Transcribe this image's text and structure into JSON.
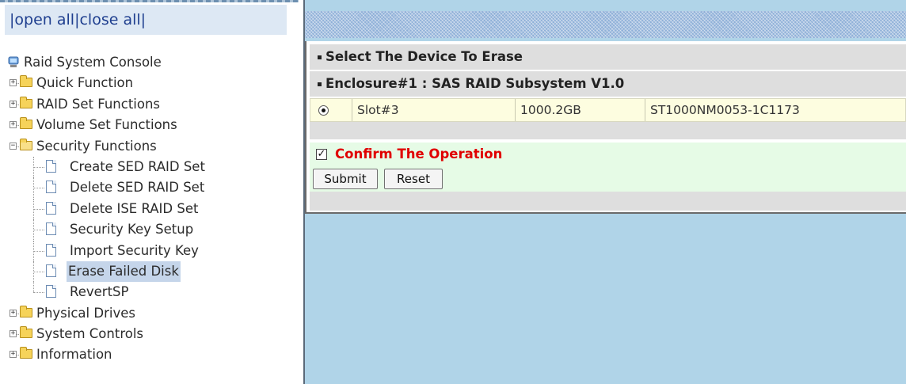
{
  "nav": {
    "open_close": {
      "pre": "|",
      "open_all": "open all",
      "sep": "|",
      "close_all": "close all",
      "post": "|"
    },
    "root": "Raid System Console",
    "items": [
      {
        "label": "Quick Function",
        "type": "folder",
        "expanded": false
      },
      {
        "label": "RAID Set Functions",
        "type": "folder",
        "expanded": false
      },
      {
        "label": "Volume Set Functions",
        "type": "folder",
        "expanded": false
      },
      {
        "label": "Security Functions",
        "type": "folder",
        "expanded": true,
        "children": [
          "Create SED RAID Set",
          "Delete SED RAID Set",
          "Delete ISE RAID Set",
          "Security Key Setup",
          "Import Security Key",
          "Erase Failed Disk",
          "RevertSP"
        ],
        "selected_child": "Erase Failed Disk"
      },
      {
        "label": "Physical Drives",
        "type": "folder",
        "expanded": false
      },
      {
        "label": "System Controls",
        "type": "folder",
        "expanded": false
      },
      {
        "label": "Information",
        "type": "folder",
        "expanded": false
      }
    ]
  },
  "main": {
    "section_title": "Select The Device To Erase",
    "enclosure_title": "Enclosure#1 : SAS RAID Subsystem V1.0",
    "device": {
      "selected": true,
      "slot": "Slot#3",
      "capacity": "1000.2GB",
      "model": "ST1000NM0053-1C1173"
    },
    "confirm": {
      "checked": true,
      "label": "Confirm The Operation",
      "color": "#e00000"
    },
    "buttons": {
      "submit": "Submit",
      "reset": "Reset"
    }
  },
  "colors": {
    "content_background": "#b0d4e8",
    "selected_item": "#c5d5ea",
    "confirm_background": "#e6fbe6",
    "device_row": "#fdfde0",
    "header_row": "#dedede"
  }
}
